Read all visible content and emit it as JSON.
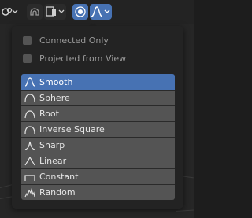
{
  "toolbar": {
    "buttons": [
      {
        "name": "pivot-icon"
      },
      {
        "name": "snap-icon"
      },
      {
        "name": "snap-target-icon"
      },
      {
        "name": "proportional-editing-icon"
      },
      {
        "name": "falloff-smooth-icon"
      }
    ]
  },
  "options": {
    "connected_only": "Connected Only",
    "projected_from_view": "Projected from View"
  },
  "falloff_items": [
    {
      "label": "Smooth",
      "icon": "smooth-falloff-icon",
      "selected": true
    },
    {
      "label": "Sphere",
      "icon": "sphere-falloff-icon",
      "selected": false
    },
    {
      "label": "Root",
      "icon": "root-falloff-icon",
      "selected": false
    },
    {
      "label": "Inverse Square",
      "icon": "inverse-square-falloff-icon",
      "selected": false
    },
    {
      "label": "Sharp",
      "icon": "sharp-falloff-icon",
      "selected": false
    },
    {
      "label": "Linear",
      "icon": "linear-falloff-icon",
      "selected": false
    },
    {
      "label": "Constant",
      "icon": "constant-falloff-icon",
      "selected": false
    },
    {
      "label": "Random",
      "icon": "random-falloff-icon",
      "selected": false
    }
  ],
  "colors": {
    "accent": "#4772b3",
    "item_bg": "#545454",
    "panel_bg": "#232323"
  }
}
